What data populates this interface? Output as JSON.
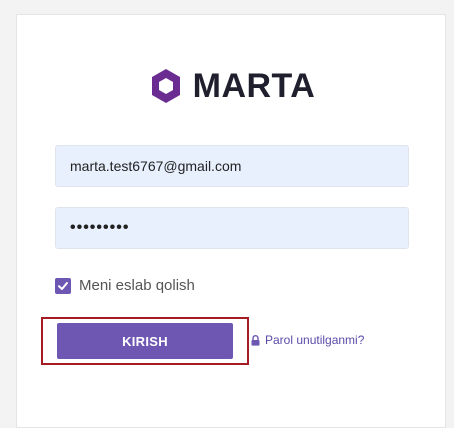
{
  "brand": {
    "name": "MARTA",
    "logo_icon": "hexagon-icon",
    "logo_color": "#6b2c91"
  },
  "form": {
    "email_value": "marta.test6767@gmail.com",
    "password_value": "•••••••••",
    "remember_label": "Meni eslab qolish",
    "remember_checked": true,
    "login_label": "KIRISH",
    "forgot_label": "Parol unutilganmi?",
    "forgot_icon": "lock-icon"
  },
  "colors": {
    "accent": "#6e57b3",
    "highlight": "#a51c24",
    "input_bg": "#e8f0fe"
  }
}
